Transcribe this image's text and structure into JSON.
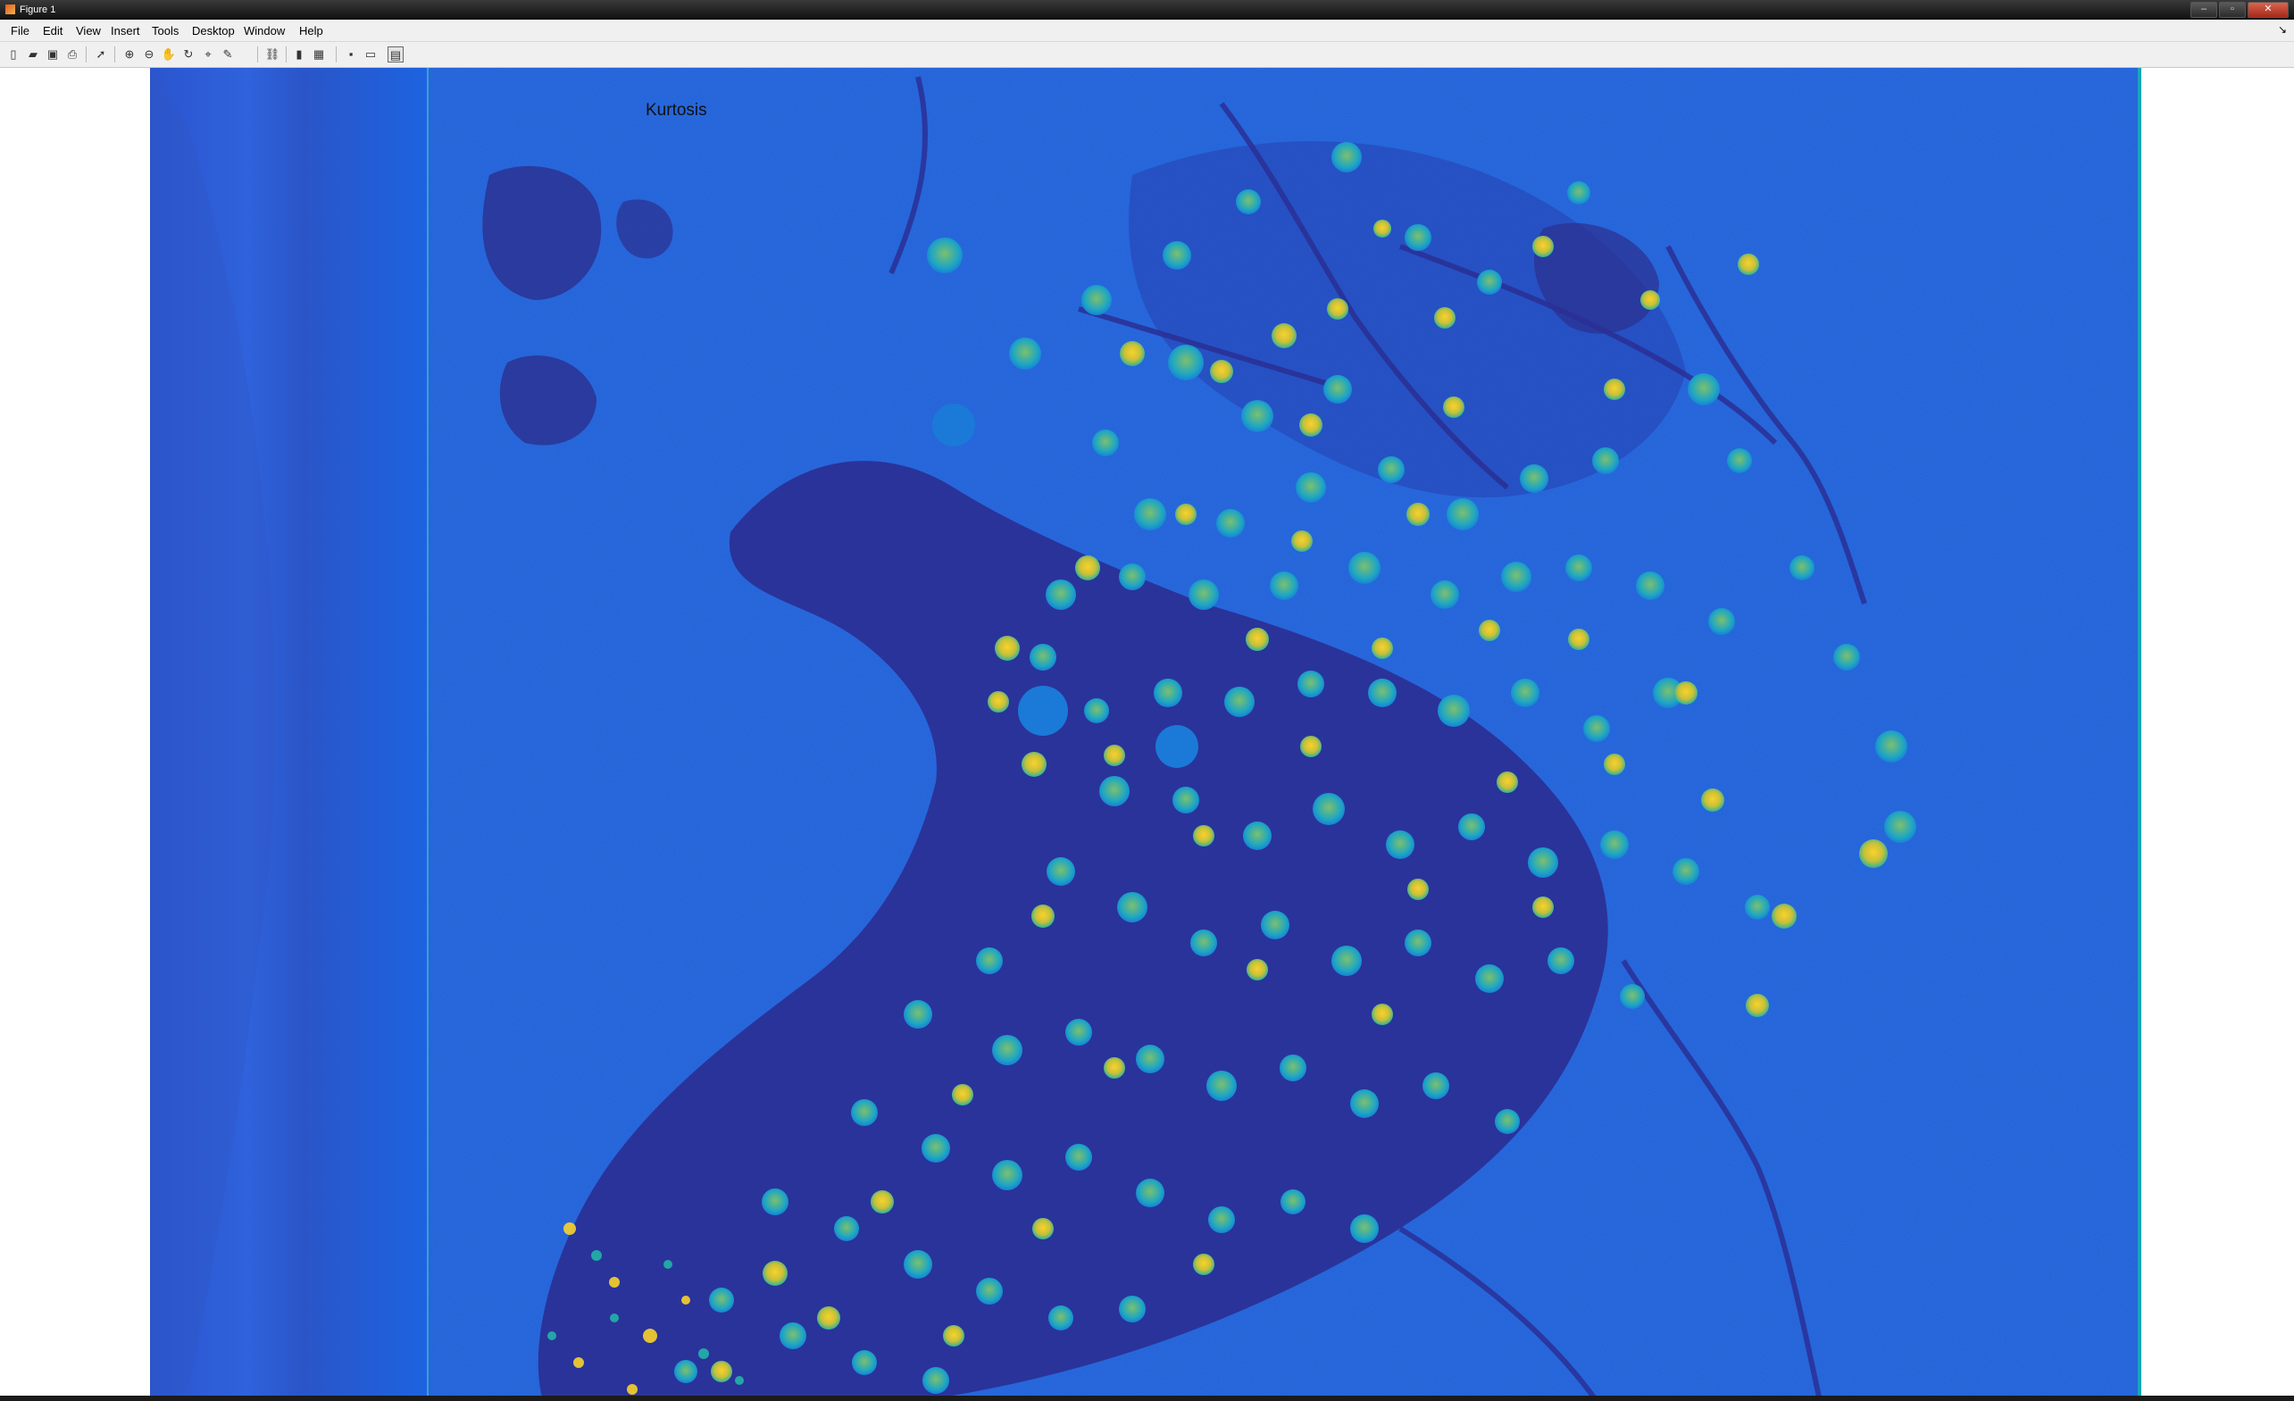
{
  "window": {
    "title": "Figure 1",
    "controls": {
      "minimize": "–",
      "maximize": "▫",
      "close": "✕"
    }
  },
  "menu": {
    "items": [
      "File",
      "Edit",
      "View",
      "Insert",
      "Tools",
      "Desktop",
      "Window",
      "Help"
    ],
    "dock_arrow": "↘"
  },
  "toolbar": {
    "icons": [
      "new-figure-icon",
      "open-file-icon",
      "save-icon",
      "print-icon",
      "edit-plot-icon",
      "zoom-in-icon",
      "zoom-out-icon",
      "pan-icon",
      "rotate-3d-icon",
      "data-cursor-icon",
      "brush-icon",
      "link-plot-icon",
      "colorbar-icon",
      "legend-icon",
      "hide-plot-tools-icon",
      "show-plot-tools-icon"
    ]
  },
  "figure": {
    "title": "Kurtosis",
    "colormap": "parula",
    "colors": {
      "low": "#352a87",
      "background": "#1f5fd8",
      "mid": "#0fa4c9",
      "high": "#f9d22a"
    }
  }
}
